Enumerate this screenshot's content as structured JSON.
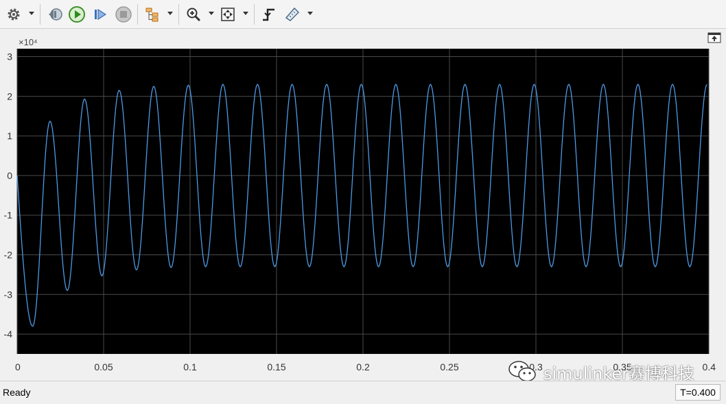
{
  "toolbar": {
    "buttons": [
      {
        "icon": "gear-icon"
      },
      {
        "icon": "step-back-icon"
      },
      {
        "icon": "run-icon"
      },
      {
        "icon": "step-forward-icon"
      },
      {
        "icon": "stop-icon"
      },
      {
        "icon": "signal-hierarchy-icon"
      },
      {
        "icon": "zoom-in-icon"
      },
      {
        "icon": "fit-to-view-icon"
      },
      {
        "icon": "triggers-icon"
      },
      {
        "icon": "cursor-measurements-icon"
      }
    ]
  },
  "scope": {
    "background": "#000000",
    "trace_color": "#4d9be6",
    "grid": true,
    "y_exponent_label": "×10⁴",
    "undock_icon": "undock-icon"
  },
  "chart_data": {
    "type": "line",
    "title": "",
    "xlabel": "",
    "ylabel": "",
    "xlim": [
      0,
      0.4
    ],
    "ylim": [
      -4.5,
      3.2
    ],
    "y_scale_factor": 10000,
    "xticks": [
      0,
      0.05,
      0.1,
      0.15,
      0.2,
      0.25,
      0.3,
      0.35,
      0.4
    ],
    "xtick_labels": [
      "0",
      "0.05",
      "0.1",
      "0.15",
      "0.2",
      "0.25",
      "0.3",
      "0.35",
      "0.4"
    ],
    "yticks": [
      -4,
      -3,
      -2,
      -1,
      0,
      1,
      2,
      3
    ],
    "ytick_labels": [
      "-4",
      "-3",
      "-2",
      "-1",
      "0",
      "1",
      "2",
      "3"
    ],
    "series": [
      {
        "frequency_hz": 50,
        "x": [
          0,
          0.009,
          0.019,
          0.029,
          0.039,
          0.049,
          0.059,
          0.069,
          0.079,
          0.089,
          0.099,
          0.109,
          0.119,
          0.129,
          0.139,
          0.149,
          0.159,
          0.169,
          0.179,
          0.189,
          0.199,
          0.209,
          0.219,
          0.229,
          0.239,
          0.249,
          0.259,
          0.269,
          0.279,
          0.289,
          0.299,
          0.309,
          0.319,
          0.329,
          0.339,
          0.349,
          0.359,
          0.369,
          0.379,
          0.389,
          0.399
        ],
        "y": [
          0,
          -3.8,
          1.37,
          -2.9,
          1.93,
          -2.53,
          2.15,
          -2.38,
          2.25,
          -2.32,
          2.28,
          -2.3,
          2.3,
          -2.3,
          2.3,
          -2.3,
          2.3,
          -2.3,
          2.3,
          -2.3,
          2.3,
          -2.3,
          2.3,
          -2.3,
          2.3,
          -2.3,
          2.3,
          -2.3,
          2.3,
          -2.3,
          2.3,
          -2.3,
          2.3,
          -2.3,
          2.3,
          -2.3,
          2.3,
          -2.3,
          2.3,
          -2.3,
          2.3
        ]
      }
    ]
  },
  "status": {
    "text": "Ready",
    "time": "T=0.400"
  },
  "watermark": {
    "text": "simulinker赛博科技"
  }
}
